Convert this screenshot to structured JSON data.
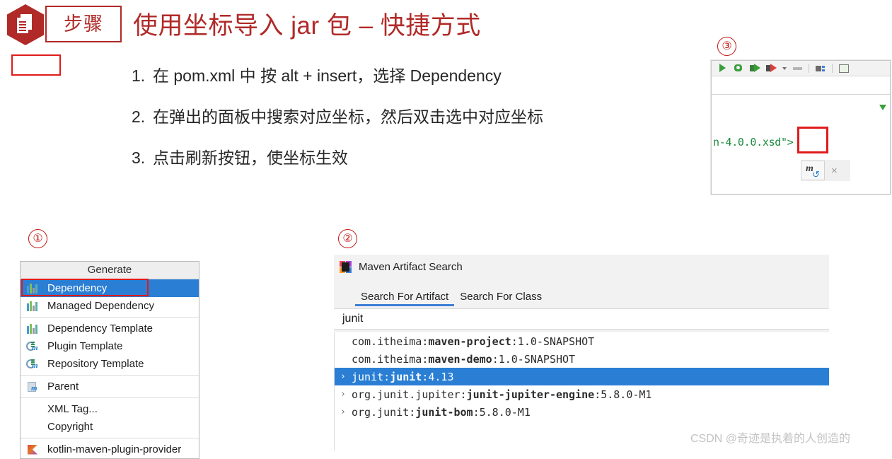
{
  "header": {
    "badge_label": "步骤",
    "badge_icon": "document-icon",
    "title": "使用坐标导入 jar 包 – 快捷方式",
    "accent_color": "#b02a28"
  },
  "steps": [
    {
      "num": "1.",
      "text": "在 pom.xml 中 按 alt + insert，选择 Dependency"
    },
    {
      "num": "2.",
      "text": "在弹出的面板中搜索对应坐标，然后双击选中对应坐标"
    },
    {
      "num": "3.",
      "text": "点击刷新按钮，使坐标生效"
    }
  ],
  "markers": {
    "one": "①",
    "two": "②",
    "three": "③",
    "color": "#c0150f"
  },
  "generate_menu": {
    "header": "Generate",
    "highlight_color": "#e01b1b",
    "selection_color": "#2a7fd4",
    "items": [
      {
        "label": "Dependency",
        "icon": "dependency-bars-icon",
        "selected": true,
        "highlighted": true
      },
      {
        "label": "Managed Dependency",
        "icon": "dependency-bars-icon",
        "selected": false,
        "highlighted": false
      },
      {
        "separator": true
      },
      {
        "label": "Dependency Template",
        "icon": "dependency-bars-icon",
        "selected": false,
        "highlighted": false
      },
      {
        "label": "Plugin Template",
        "icon": "plugin-maven-icon",
        "selected": false,
        "highlighted": false
      },
      {
        "label": "Repository Template",
        "icon": "repository-maven-icon",
        "selected": false,
        "highlighted": false
      },
      {
        "separator": true
      },
      {
        "label": "Parent",
        "icon": "parent-file-icon",
        "selected": false,
        "highlighted": false
      },
      {
        "separator": true
      },
      {
        "label": "XML Tag...",
        "icon": "none",
        "selected": false,
        "highlighted": false
      },
      {
        "label": "Copyright",
        "icon": "none",
        "selected": false,
        "highlighted": false
      },
      {
        "separator": true
      },
      {
        "label": "kotlin-maven-plugin-provider",
        "icon": "kotlin-icon",
        "selected": false,
        "highlighted": false
      }
    ]
  },
  "maven_dialog": {
    "title": "Maven Artifact Search",
    "app_icon": "intellij-idea-icon",
    "tabs": [
      {
        "label": "Search For Artifact",
        "active": true
      },
      {
        "label": "Search For Class",
        "active": false
      }
    ],
    "search_value": "junit",
    "search_placeholder": "",
    "results": [
      {
        "group": "com.itheima:",
        "artifact": "maven-project",
        "version": ":1.0-SNAPSHOT",
        "expandable": false,
        "selected": false
      },
      {
        "group": "com.itheima:",
        "artifact": "maven-demo",
        "version": ":1.0-SNAPSHOT",
        "expandable": false,
        "selected": false
      },
      {
        "group": "junit:",
        "artifact": "junit",
        "version": ":4.13",
        "expandable": true,
        "selected": true
      },
      {
        "group": "org.junit.jupiter:",
        "artifact": "junit-jupiter-engine",
        "version": ":5.8.0-M1",
        "expandable": true,
        "selected": false
      },
      {
        "group": "org.junit:",
        "artifact": "junit-bom",
        "version": ":5.8.0-M1",
        "expandable": true,
        "selected": false
      }
    ]
  },
  "ide_snippet": {
    "code_line": "n-4.0.0.xsd\">",
    "code_color": "#1a8a3a",
    "maven_reload_button": {
      "glyph": "m",
      "refresh_icon": "refresh-icon",
      "close_icon": "×"
    },
    "toolbar_icons": [
      "run-icon",
      "debug-icon",
      "step-over-icon",
      "stop-record-icon",
      "dropdown-caret-icon",
      "stop-icon",
      "layout-icon",
      "terminal-icon"
    ]
  },
  "watermark": "CSDN @奇迹是执着的人创造的"
}
